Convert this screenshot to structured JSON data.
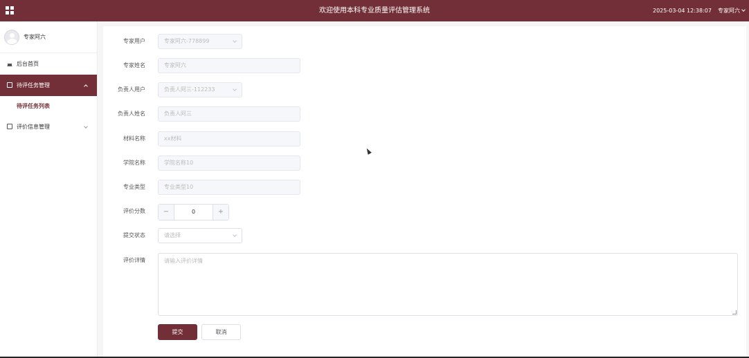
{
  "header": {
    "title": "欢迎使用本科专业质量评估管理系统",
    "datetime": "2025-03-04 12:38:07",
    "user": "专家阿六",
    "menu_icon": "grid-icon",
    "bg_color": "#722f37"
  },
  "sidebar": {
    "profile_name": "专家阿六",
    "items": [
      {
        "label": "后台首页",
        "icon": "home-icon"
      },
      {
        "label": "待评任务管理",
        "icon": "document-icon",
        "active": true,
        "expanded": true
      },
      {
        "label": "评价信息管理",
        "icon": "document-icon",
        "expanded": false
      }
    ],
    "submenu": {
      "label": "待评任务列表"
    }
  },
  "form": {
    "expert_user": {
      "label": "专家用户",
      "value": "专家阿六-778899"
    },
    "expert_name": {
      "label": "专家姓名",
      "value": "专家阿六"
    },
    "owner_user": {
      "label": "负责人用户",
      "value": "负责人阿三-112233"
    },
    "owner_name": {
      "label": "负责人姓名",
      "value": "负责人阿三"
    },
    "material_name": {
      "label": "材料名称",
      "value": "xx材料"
    },
    "college_name": {
      "label": "学院名称",
      "value": "学院名称10"
    },
    "major_type": {
      "label": "专业类型",
      "value": "专业类型10"
    },
    "score": {
      "label": "评价分数",
      "value": "0",
      "minus": "−",
      "plus": "+"
    },
    "submit_status": {
      "label": "提交状态",
      "placeholder": "请选择"
    },
    "detail": {
      "label": "评价详情",
      "placeholder": "请输入评价详情"
    },
    "submit_button": "提交",
    "cancel_button": "取消"
  }
}
